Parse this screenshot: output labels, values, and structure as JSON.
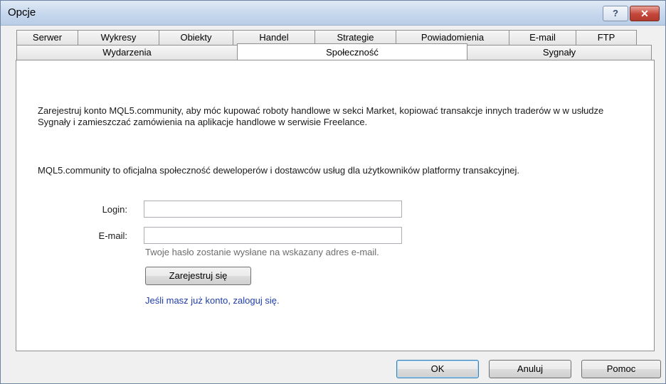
{
  "window": {
    "title": "Opcje",
    "help_glyph": "?",
    "close_glyph": "✕"
  },
  "tabs_back": [
    "Serwer",
    "Wykresy",
    "Obiekty",
    "Handel",
    "Strategie",
    "Powiadomienia",
    "E-mail",
    "FTP"
  ],
  "tabs_front": [
    "Wydarzenia",
    "Społeczność",
    "Sygnały"
  ],
  "active_tab": "Społeczność",
  "content": {
    "para1": "Zarejestruj konto MQL5.community, aby móc kupować roboty handlowe w sekci Market, kopiować transakcje innych traderów w w usłudze Sygnały i zamieszczać zamówienia na aplikacje handlowe w serwisie Freelance.",
    "para2": "MQL5.community to oficjalna społeczność deweloperów i dostawców usług dla użytkowników platformy transakcyjnej.",
    "login_label": "Login:",
    "login_value": "",
    "email_label": "E-mail:",
    "email_value": "",
    "hint": "Twoje hasło zostanie wysłane na wskazany adres e-mail.",
    "register_button": "Zarejestruj się",
    "login_link": "Jeśli masz już konto, zaloguj się."
  },
  "footer": {
    "ok": "OK",
    "cancel": "Anuluj",
    "help": "Pomoc"
  },
  "colors": {
    "link": "#1f3da8",
    "close_button": "#c4463a"
  }
}
